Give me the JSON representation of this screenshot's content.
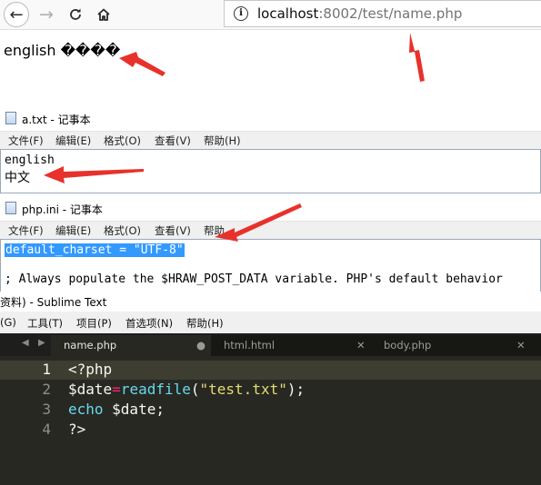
{
  "browser": {
    "url_host": "localhost",
    "url_port": ":8002",
    "url_path": "/test/name.php",
    "page_text": "english ����"
  },
  "notepad_a": {
    "title": "a.txt - 记事本",
    "menu": [
      "文件(F)",
      "编辑(E)",
      "格式(O)",
      "查看(V)",
      "帮助(H)"
    ],
    "lines": [
      "english",
      "中文"
    ]
  },
  "notepad_php": {
    "title": "php.ini - 记事本",
    "menu": [
      "文件(F)",
      "编辑(E)",
      "格式(O)",
      "查看(V)",
      "帮助"
    ],
    "selected_line": "default_charset = \"UTF-8\"",
    "line3": "; Always populate the $HRAW_POST_DATA variable. PHP's default behavior"
  },
  "sublime": {
    "title": "资料) - Sublime Text",
    "menu": [
      "(G)",
      "工具(T)",
      "项目(P)",
      "首选项(N)",
      "帮助(H)"
    ],
    "tabs": [
      "name.php",
      "html.html",
      "body.php"
    ],
    "line_numbers": [
      "1",
      "2",
      "3",
      "4"
    ],
    "code": {
      "l1": "<?php",
      "l2_var": "$date",
      "l2_eq": "=",
      "l2_fn": "readfile",
      "l2_open": "(",
      "l2_str": "\"test.txt\"",
      "l2_close": ");",
      "l3_kw": "echo",
      "l3_rest": " $date;",
      "l4": "?>"
    }
  },
  "colors": {
    "annotation_arrow": "#e8312b",
    "selection": "#3399ff",
    "monokai_bg": "#272822",
    "monokai_pink": "#f92672",
    "monokai_blue": "#66d9ef",
    "monokai_yellow": "#e6db74"
  }
}
